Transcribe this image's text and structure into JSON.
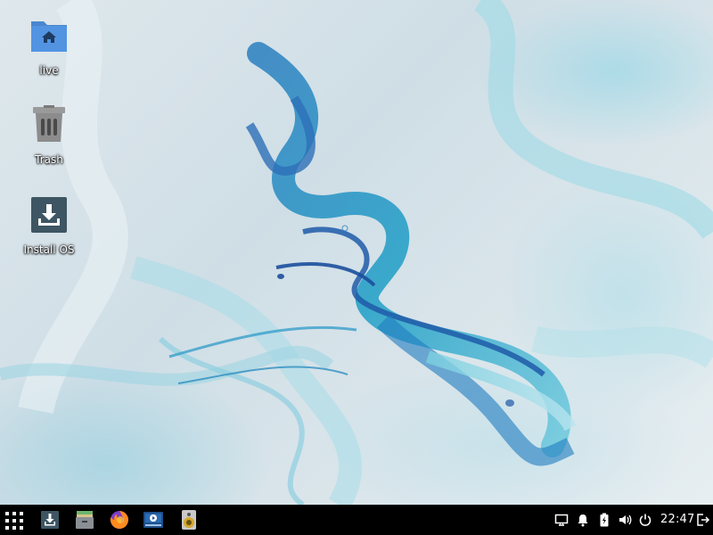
{
  "desktop": {
    "icons": [
      {
        "label": "live",
        "icon": "home-folder-icon"
      },
      {
        "label": "Trash",
        "icon": "trash-icon"
      },
      {
        "label": "Install OS",
        "icon": "install-os-icon"
      }
    ]
  },
  "taskbar": {
    "launcher_icon": "app-grid-icon",
    "tasks": [
      {
        "icon": "installer-download-icon"
      },
      {
        "icon": "file-manager-icon"
      },
      {
        "icon": "firefox-icon"
      },
      {
        "icon": "media-player-icon"
      },
      {
        "icon": "speaker-app-icon"
      }
    ],
    "tray": [
      {
        "icon": "display-icon"
      },
      {
        "icon": "notification-bell-icon"
      },
      {
        "icon": "battery-charging-icon"
      },
      {
        "icon": "volume-icon"
      },
      {
        "icon": "power-icon"
      }
    ],
    "clock": "22:47",
    "logout_icon": "logout-icon"
  },
  "colors": {
    "taskbar_bg": "#000000",
    "folder_blue": "#5294e2",
    "trash_gray": "#8c8c8c",
    "installer_slate": "#3e5563"
  }
}
